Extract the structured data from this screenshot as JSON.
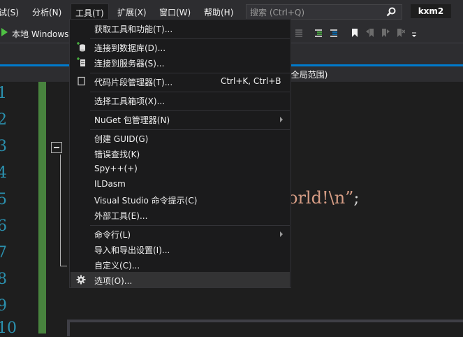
{
  "menubar": {
    "items": [
      "试(S)",
      "分析(N)",
      "工具(T)",
      "扩展(X)",
      "窗口(W)",
      "帮助(H)"
    ],
    "search_placeholder": "搜索 (Ctrl+Q)",
    "user": "kxm2"
  },
  "toolbar": {
    "run_target": "本地 Windows"
  },
  "navbar": {
    "scope": "(全局范围)"
  },
  "editor": {
    "line_numbers": [
      "1",
      "2",
      "3",
      "4",
      "5",
      "6",
      "7",
      "8",
      "9",
      "10"
    ],
    "code_fragment": "orld!\\n”",
    "code_semicolon": ";"
  },
  "tools_menu": {
    "items": [
      {
        "label": "获取工具和功能(T)..."
      },
      {
        "label": "连接到数据库(D)...",
        "icon": "database-connect-icon"
      },
      {
        "label": "连接到服务器(S)...",
        "icon": "server-connect-icon"
      },
      {
        "label": "代码片段管理器(T)...",
        "shortcut": "Ctrl+K, Ctrl+B",
        "icon": "checkbox-icon"
      },
      {
        "label": "选择工具箱项(X)..."
      },
      {
        "label": "NuGet 包管理器(N)",
        "submenu": true
      },
      {
        "label": "创建 GUID(G)"
      },
      {
        "label": "错误查找(K)"
      },
      {
        "label": "Spy++(+)"
      },
      {
        "label": "ILDasm"
      },
      {
        "label": "Visual Studio 命令提示(C)"
      },
      {
        "label": "外部工具(E)..."
      },
      {
        "label": "命令行(L)",
        "submenu": true
      },
      {
        "label": "导入和导出设置(I)..."
      },
      {
        "label": "自定义(C)..."
      },
      {
        "label": "选项(O)...",
        "icon": "gear-icon"
      }
    ]
  },
  "colors": {
    "accent": "#007acc",
    "run_green": "#4fc144",
    "line_number": "#2b91af",
    "string": "#d69d85",
    "change_bar": "#57a64a"
  }
}
